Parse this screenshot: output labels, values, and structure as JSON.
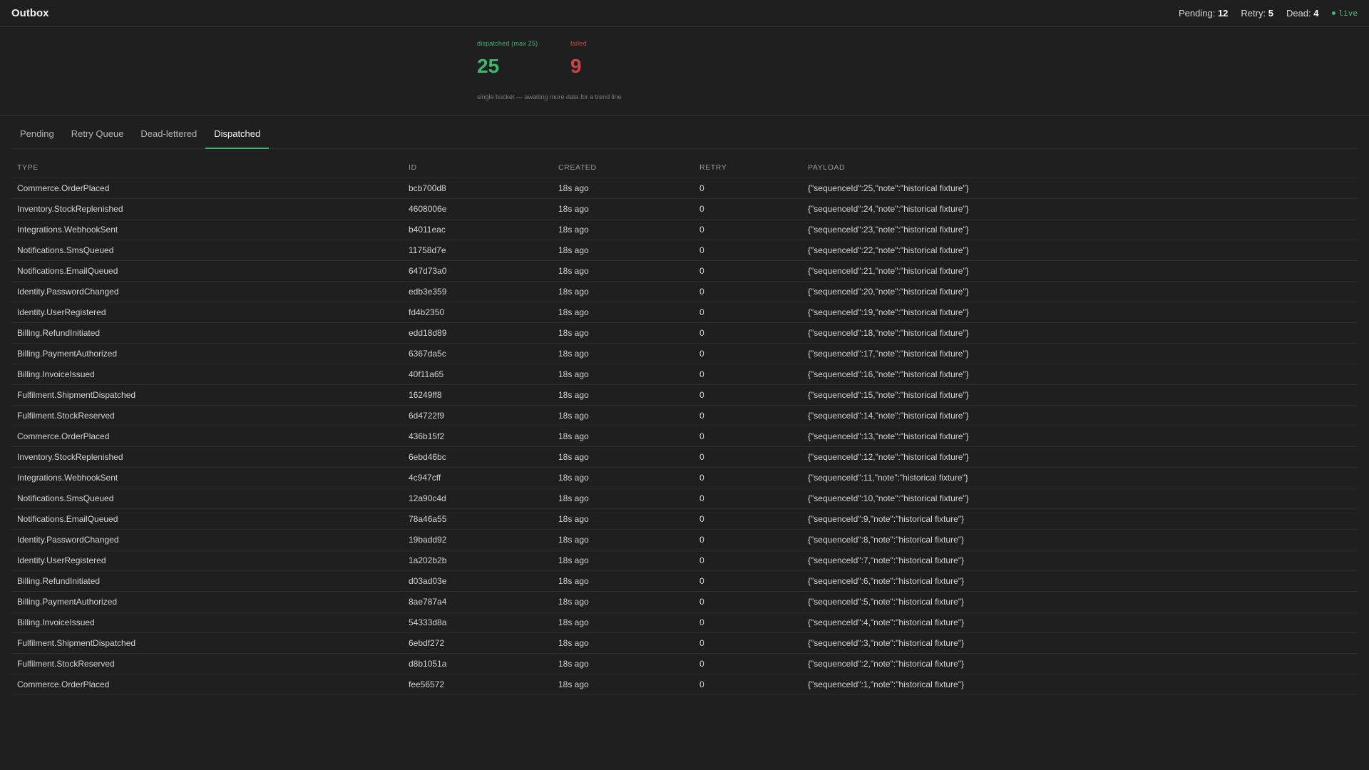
{
  "header": {
    "title": "Outbox",
    "pending_label": "Pending:",
    "pending_value": "12",
    "retry_label": "Retry:",
    "retry_value": "5",
    "dead_label": "Dead:",
    "dead_value": "4",
    "live_label": "live"
  },
  "metrics": {
    "dispatched_label": "dispatched (max 25)",
    "dispatched_value": "25",
    "failed_label": "failed",
    "failed_value": "9",
    "note": "single bucket — awaiting more data for a trend line"
  },
  "colors": {
    "accent": "#3fb66f",
    "failed": "#cf4545",
    "background": "#1f1f1f"
  },
  "tabs": [
    {
      "label": "Pending"
    },
    {
      "label": "Retry Queue"
    },
    {
      "label": "Dead-lettered"
    },
    {
      "label": "Dispatched",
      "active": true
    }
  ],
  "table": {
    "columns": [
      "TYPE",
      "ID",
      "CREATED",
      "RETRY",
      "PAYLOAD"
    ],
    "rows": [
      {
        "type": "Commerce.OrderPlaced",
        "id": "bcb700d8",
        "created": "18s ago",
        "retry": "0",
        "payload": "{\"sequenceId\":25,\"note\":\"historical fixture\"}"
      },
      {
        "type": "Inventory.StockReplenished",
        "id": "4608006e",
        "created": "18s ago",
        "retry": "0",
        "payload": "{\"sequenceId\":24,\"note\":\"historical fixture\"}"
      },
      {
        "type": "Integrations.WebhookSent",
        "id": "b4011eac",
        "created": "18s ago",
        "retry": "0",
        "payload": "{\"sequenceId\":23,\"note\":\"historical fixture\"}"
      },
      {
        "type": "Notifications.SmsQueued",
        "id": "11758d7e",
        "created": "18s ago",
        "retry": "0",
        "payload": "{\"sequenceId\":22,\"note\":\"historical fixture\"}"
      },
      {
        "type": "Notifications.EmailQueued",
        "id": "647d73a0",
        "created": "18s ago",
        "retry": "0",
        "payload": "{\"sequenceId\":21,\"note\":\"historical fixture\"}"
      },
      {
        "type": "Identity.PasswordChanged",
        "id": "edb3e359",
        "created": "18s ago",
        "retry": "0",
        "payload": "{\"sequenceId\":20,\"note\":\"historical fixture\"}"
      },
      {
        "type": "Identity.UserRegistered",
        "id": "fd4b2350",
        "created": "18s ago",
        "retry": "0",
        "payload": "{\"sequenceId\":19,\"note\":\"historical fixture\"}"
      },
      {
        "type": "Billing.RefundInitiated",
        "id": "edd18d89",
        "created": "18s ago",
        "retry": "0",
        "payload": "{\"sequenceId\":18,\"note\":\"historical fixture\"}"
      },
      {
        "type": "Billing.PaymentAuthorized",
        "id": "6367da5c",
        "created": "18s ago",
        "retry": "0",
        "payload": "{\"sequenceId\":17,\"note\":\"historical fixture\"}"
      },
      {
        "type": "Billing.InvoiceIssued",
        "id": "40f11a65",
        "created": "18s ago",
        "retry": "0",
        "payload": "{\"sequenceId\":16,\"note\":\"historical fixture\"}"
      },
      {
        "type": "Fulfilment.ShipmentDispatched",
        "id": "16249ff8",
        "created": "18s ago",
        "retry": "0",
        "payload": "{\"sequenceId\":15,\"note\":\"historical fixture\"}"
      },
      {
        "type": "Fulfilment.StockReserved",
        "id": "6d4722f9",
        "created": "18s ago",
        "retry": "0",
        "payload": "{\"sequenceId\":14,\"note\":\"historical fixture\"}"
      },
      {
        "type": "Commerce.OrderPlaced",
        "id": "436b15f2",
        "created": "18s ago",
        "retry": "0",
        "payload": "{\"sequenceId\":13,\"note\":\"historical fixture\"}"
      },
      {
        "type": "Inventory.StockReplenished",
        "id": "6ebd46bc",
        "created": "18s ago",
        "retry": "0",
        "payload": "{\"sequenceId\":12,\"note\":\"historical fixture\"}"
      },
      {
        "type": "Integrations.WebhookSent",
        "id": "4c947cff",
        "created": "18s ago",
        "retry": "0",
        "payload": "{\"sequenceId\":11,\"note\":\"historical fixture\"}"
      },
      {
        "type": "Notifications.SmsQueued",
        "id": "12a90c4d",
        "created": "18s ago",
        "retry": "0",
        "payload": "{\"sequenceId\":10,\"note\":\"historical fixture\"}"
      },
      {
        "type": "Notifications.EmailQueued",
        "id": "78a46a55",
        "created": "18s ago",
        "retry": "0",
        "payload": "{\"sequenceId\":9,\"note\":\"historical fixture\"}"
      },
      {
        "type": "Identity.PasswordChanged",
        "id": "19badd92",
        "created": "18s ago",
        "retry": "0",
        "payload": "{\"sequenceId\":8,\"note\":\"historical fixture\"}"
      },
      {
        "type": "Identity.UserRegistered",
        "id": "1a202b2b",
        "created": "18s ago",
        "retry": "0",
        "payload": "{\"sequenceId\":7,\"note\":\"historical fixture\"}"
      },
      {
        "type": "Billing.RefundInitiated",
        "id": "d03ad03e",
        "created": "18s ago",
        "retry": "0",
        "payload": "{\"sequenceId\":6,\"note\":\"historical fixture\"}"
      },
      {
        "type": "Billing.PaymentAuthorized",
        "id": "8ae787a4",
        "created": "18s ago",
        "retry": "0",
        "payload": "{\"sequenceId\":5,\"note\":\"historical fixture\"}"
      },
      {
        "type": "Billing.InvoiceIssued",
        "id": "54333d8a",
        "created": "18s ago",
        "retry": "0",
        "payload": "{\"sequenceId\":4,\"note\":\"historical fixture\"}"
      },
      {
        "type": "Fulfilment.ShipmentDispatched",
        "id": "6ebdf272",
        "created": "18s ago",
        "retry": "0",
        "payload": "{\"sequenceId\":3,\"note\":\"historical fixture\"}"
      },
      {
        "type": "Fulfilment.StockReserved",
        "id": "d8b1051a",
        "created": "18s ago",
        "retry": "0",
        "payload": "{\"sequenceId\":2,\"note\":\"historical fixture\"}"
      },
      {
        "type": "Commerce.OrderPlaced",
        "id": "fee56572",
        "created": "18s ago",
        "retry": "0",
        "payload": "{\"sequenceId\":1,\"note\":\"historical fixture\"}"
      }
    ]
  }
}
